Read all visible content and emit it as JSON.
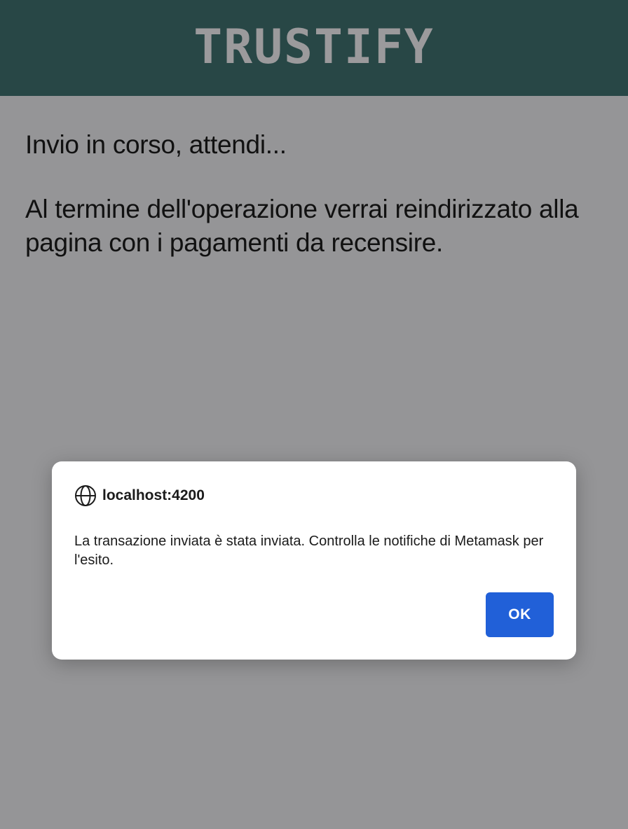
{
  "header": {
    "title": "TRUSTIFY",
    "background_color": "#284746"
  },
  "main": {
    "status_text": "Invio in corso, attendi...",
    "redirect_text": "Al termine dell'operazione verrai reindirizzato alla pagina con i pagamenti da recensire."
  },
  "dialog": {
    "origin": "localhost:4200",
    "origin_icon": "globe-icon",
    "message": "La transazione inviata è stata inviata. Controlla le notifiche di Metamask per l'esito.",
    "ok_label": "OK",
    "ok_color": "#2160d8"
  }
}
